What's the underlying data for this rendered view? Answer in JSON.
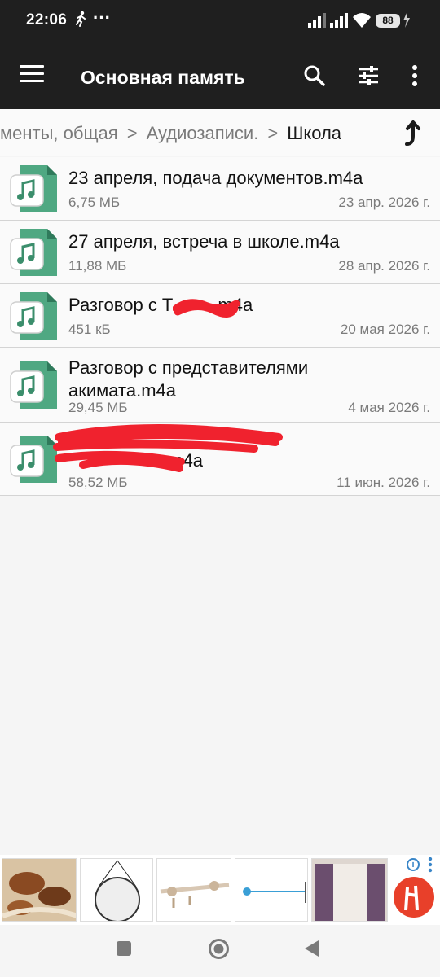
{
  "status": {
    "time": "22:06",
    "battery": "88"
  },
  "appbar": {
    "title": "Основная память",
    "icons": [
      "menu-icon",
      "search-icon",
      "filter-sliders-icon",
      "more-vert-icon"
    ]
  },
  "breadcrumbs": {
    "items": [
      "менты, общая",
      "Аудиозаписи.",
      "Школа"
    ],
    "up_icon": "arrow-up-icon"
  },
  "files": [
    {
      "name": "23 апреля, подача документов.m4a",
      "size": "6,75 МБ",
      "date": "23 апр. 2026 г."
    },
    {
      "name": "27 апреля, встреча в школе.m4a",
      "size": "11,88 МБ",
      "date": "28 апр. 2026 г."
    },
    {
      "name": "Разговор с Т        .m4a",
      "size": "451 кБ",
      "date": "20 мая 2026 г."
    },
    {
      "name": "Разговор с представителями акимата.m4a",
      "size": "29,45 МБ",
      "date": "4 мая 2026 г."
    },
    {
      "name": "                    m4a",
      "size": "58,52 МБ",
      "date": "11 июн. 2026 г."
    }
  ],
  "colors": {
    "appbar_bg": "#1f1f1f",
    "file_icon": "#4fa882",
    "redaction": "#f0222e"
  },
  "ad_icons": [
    "blanket-ad-icon",
    "mirror-ad-icon",
    "curtain-rod-ad-icon",
    "hook-rod-ad-icon",
    "curtains-ad-icon",
    "brand-logo-ad-icon"
  ],
  "nav_icons": [
    "recents-square-icon",
    "home-circle-icon",
    "back-triangle-icon"
  ]
}
